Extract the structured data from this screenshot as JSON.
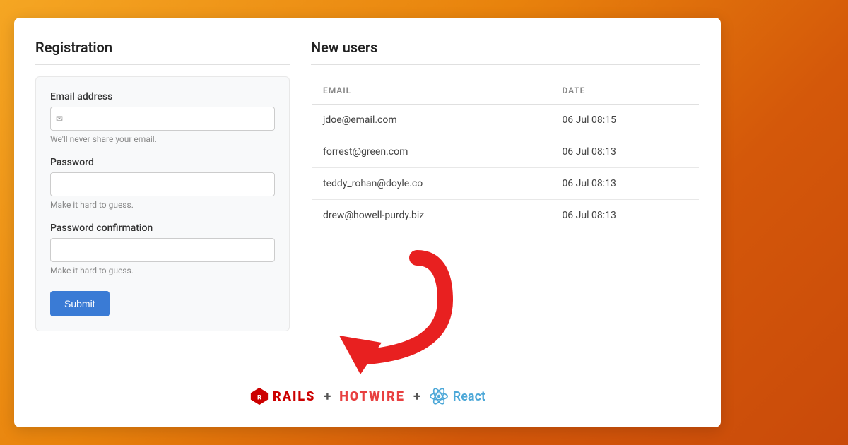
{
  "registration": {
    "title": "Registration",
    "form": {
      "email": {
        "label": "Email address",
        "placeholder": "",
        "hint": "We'll never share your email."
      },
      "password": {
        "label": "Password",
        "placeholder": "",
        "hint": "Make it hard to guess."
      },
      "password_confirmation": {
        "label": "Password confirmation",
        "placeholder": "",
        "hint": "Make it hard to guess."
      },
      "submit_label": "Submit"
    }
  },
  "new_users": {
    "title": "New users",
    "table": {
      "headers": [
        "EMAIL",
        "DATE"
      ],
      "rows": [
        {
          "email": "jdoe@email.com",
          "date": "06 Jul 08:15"
        },
        {
          "email": "forrest@green.com",
          "date": "06 Jul 08:13"
        },
        {
          "email": "teddy_rohan@doyle.co",
          "date": "06 Jul 08:13"
        },
        {
          "email": "drew@howell-purdy.biz",
          "date": "06 Jul 08:13"
        }
      ]
    }
  },
  "logos": {
    "rails": "RAILS",
    "plus1": "+",
    "hotwire": "HOTWIRE",
    "plus2": "+",
    "react": "React"
  },
  "arrow": {
    "color": "#e82020"
  }
}
